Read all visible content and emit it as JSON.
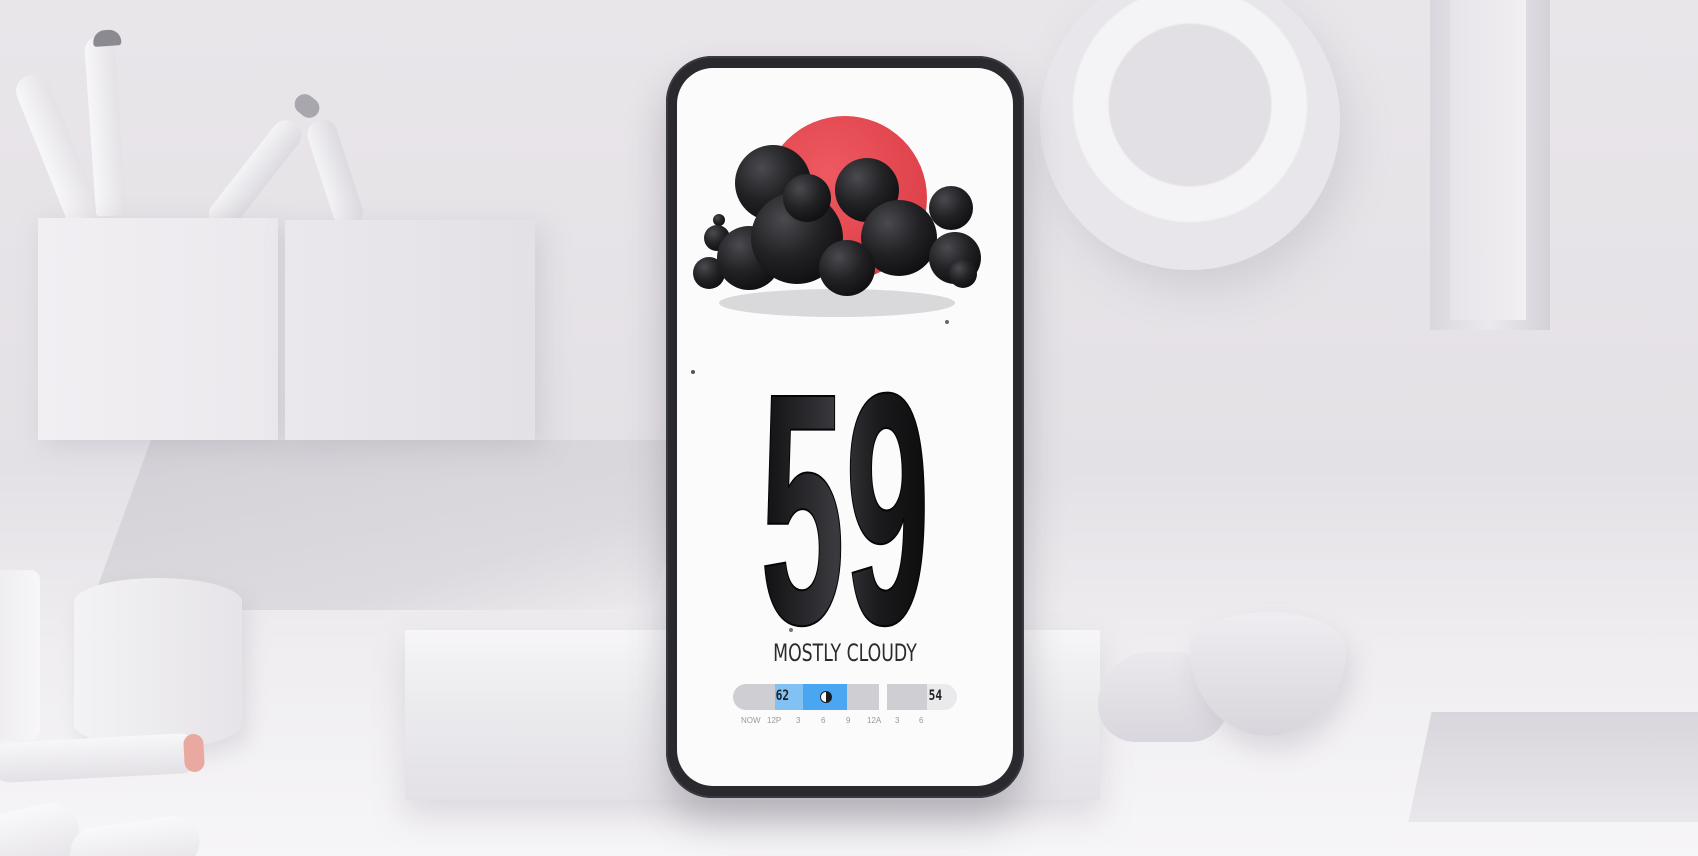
{
  "weather": {
    "temperature": "59",
    "condition": "MOSTLY CLOUDY",
    "icon": "cloud-over-sun-icon"
  },
  "hourly": {
    "high": "62",
    "low": "54",
    "now_icon": "half-circle-icon",
    "ticks": [
      "NOW",
      "12P",
      "3",
      "6",
      "9",
      "12A",
      "3",
      "6"
    ]
  },
  "colors": {
    "sun": "#e84a52",
    "cloud": "#1f1f22",
    "now_highlight": "#4aa6f0",
    "track": "#cfcfd3",
    "phone_body": "#2a292e",
    "screen": "#fbfbfb"
  }
}
